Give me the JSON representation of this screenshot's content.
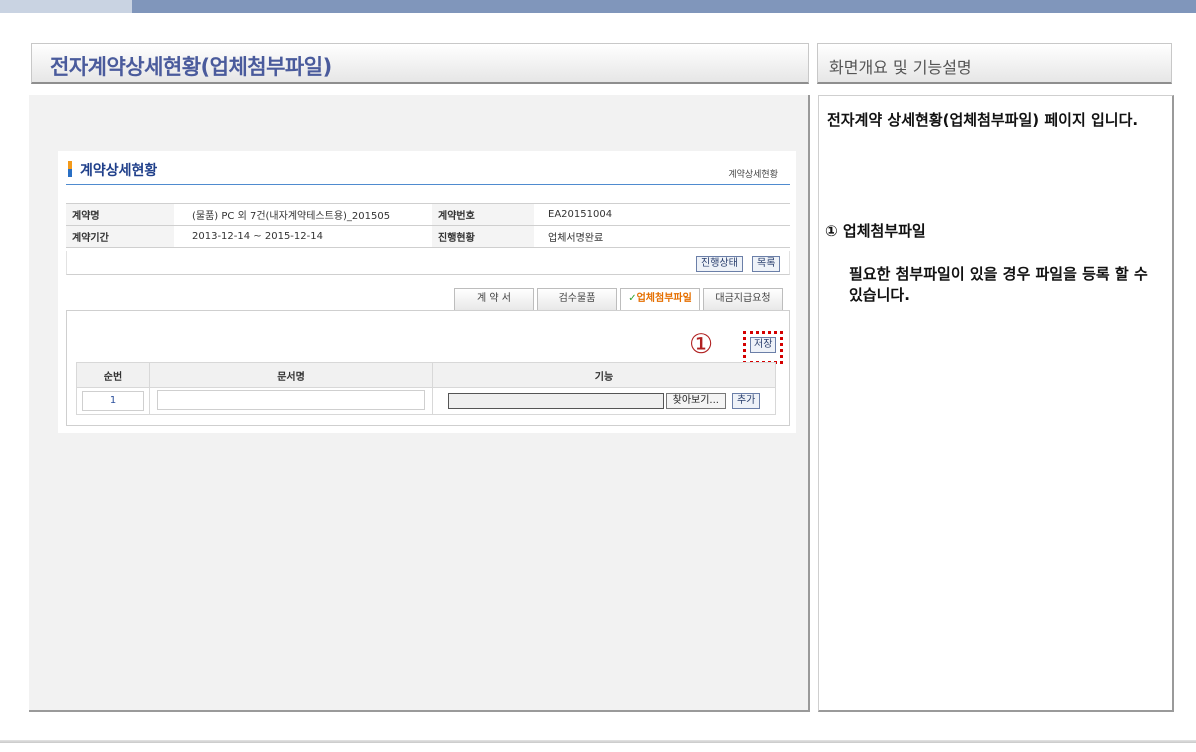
{
  "page": {
    "title": "전자계약상세현황(업체첨부파일)",
    "side_title": "화면개요 및 기능설명"
  },
  "screenshot": {
    "title": "계약상세현황",
    "breadcrumb": "계약상세현황",
    "info": {
      "contract_name_label": "계약명",
      "contract_name": "(물품) PC 외 7건(내자계약테스트용)_201505",
      "contract_no_label": "계약번호",
      "contract_no": "EA20151004",
      "period_label": "계약기간",
      "period": "2013-12-14 ~ 2015-12-14",
      "progress_label": "진행현황",
      "progress": "업체서명완료"
    },
    "buttons": {
      "status": "진행상태",
      "list": "목록",
      "save": "저장",
      "browse": "찾아보기...",
      "add": "추가"
    },
    "tabs": [
      {
        "label": "계 약 서",
        "active": false
      },
      {
        "label": "검수물품",
        "active": false
      },
      {
        "label": "업체첨부파일",
        "active": true
      },
      {
        "label": "대금지급요청",
        "active": false
      }
    ],
    "marker": "①",
    "file_table": {
      "headers": [
        "순번",
        "문서명",
        "기능"
      ],
      "rows": [
        {
          "seq": "1"
        }
      ]
    }
  },
  "description": {
    "heading": "전자계약 상세현황(업체첨부파일) 페이지 입니다.",
    "item_title": "① 업체첨부파일",
    "item_desc": "필요한 첨부파일이 있을 경우 파일을 등록 할 수 있습니다."
  }
}
